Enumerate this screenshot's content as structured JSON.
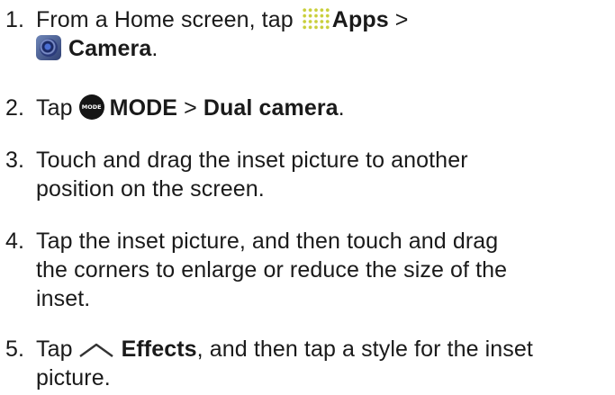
{
  "steps": [
    {
      "number": "1.",
      "line1_prefix": "From a Home screen, tap",
      "apps_label": "Apps",
      "separator": ">",
      "camera_label": "Camera",
      "end": "."
    },
    {
      "number": "2.",
      "prefix": "Tap",
      "mode_icon_text": "MODE",
      "mode_label": "MODE",
      "separator": ">",
      "dual_label": "Dual camera",
      "end": "."
    },
    {
      "number": "3.",
      "line1": "Touch and drag the inset picture to another",
      "line2": "position on the screen."
    },
    {
      "number": "4.",
      "line1": "Tap the inset picture, and then touch and drag",
      "line2": "the corners to enlarge or reduce the size of the",
      "line3": "inset."
    },
    {
      "number": "5.",
      "prefix": "Tap",
      "effects_label": "Effects",
      "line1_rest": ", and then tap a style for the inset",
      "line2": "picture."
    }
  ],
  "icons": [
    "apps-grid-icon",
    "camera-icon",
    "mode-icon",
    "chevron-up-icon"
  ],
  "colors": {
    "text": "#1a1a1a",
    "apps_icon": "#c9cf3a",
    "camera_icon": "#2f3f73",
    "mode_icon": "#151515"
  }
}
